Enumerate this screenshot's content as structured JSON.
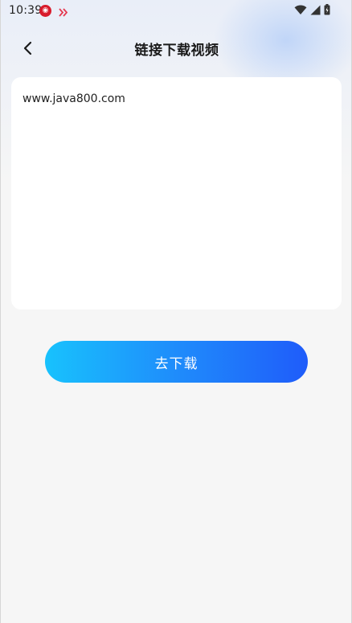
{
  "status_bar": {
    "time": "10:39",
    "notification_icons": [
      "china-unicom-icon",
      "app-notification-icon"
    ],
    "system_icons": [
      "wifi-icon",
      "signal-icon",
      "battery-icon"
    ]
  },
  "header": {
    "title": "链接下载视频",
    "back_icon": "chevron-left-icon"
  },
  "link_input": {
    "value": "www.java800.com",
    "placeholder": ""
  },
  "actions": {
    "download_label": "去下载"
  },
  "colors": {
    "button_gradient_start": "#18c2fd",
    "button_gradient_end": "#1f5cfa",
    "page_background": "#f6f6f6",
    "card_background": "#ffffff"
  }
}
